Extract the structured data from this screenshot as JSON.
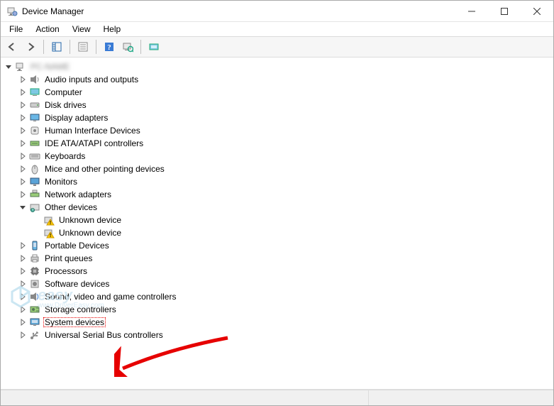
{
  "window": {
    "title": "Device Manager"
  },
  "menu": {
    "file": "File",
    "action": "Action",
    "view": "View",
    "help": "Help"
  },
  "toolbar": {
    "back": "Back",
    "forward": "Forward",
    "show_hide_tree": "Show/Hide Console Tree",
    "properties": "Properties",
    "help": "Help",
    "scan": "Scan for hardware changes",
    "show_hidden": "Show hidden devices"
  },
  "tree": {
    "root_label": "PC-NAME",
    "items": [
      {
        "label": "Audio inputs and outputs",
        "icon": "audio"
      },
      {
        "label": "Computer",
        "icon": "computer"
      },
      {
        "label": "Disk drives",
        "icon": "disk"
      },
      {
        "label": "Display adapters",
        "icon": "display"
      },
      {
        "label": "Human Interface Devices",
        "icon": "hid"
      },
      {
        "label": "IDE ATA/ATAPI controllers",
        "icon": "ide"
      },
      {
        "label": "Keyboards",
        "icon": "keyboard"
      },
      {
        "label": "Mice and other pointing devices",
        "icon": "mouse"
      },
      {
        "label": "Monitors",
        "icon": "monitor"
      },
      {
        "label": "Network adapters",
        "icon": "network"
      },
      {
        "label": "Other devices",
        "icon": "other",
        "expanded": true,
        "children": [
          {
            "label": "Unknown device",
            "icon": "warning"
          },
          {
            "label": "Unknown device",
            "icon": "warning"
          }
        ]
      },
      {
        "label": "Portable Devices",
        "icon": "portable"
      },
      {
        "label": "Print queues",
        "icon": "printer"
      },
      {
        "label": "Processors",
        "icon": "cpu"
      },
      {
        "label": "Software devices",
        "icon": "software"
      },
      {
        "label": "Sound, video and game controllers",
        "icon": "sound"
      },
      {
        "label": "Storage controllers",
        "icon": "storage"
      },
      {
        "label": "System devices",
        "icon": "system",
        "selected": true
      },
      {
        "label": "Universal Serial Bus controllers",
        "icon": "usb"
      }
    ]
  },
  "watermark": {
    "brand": "easy",
    "sub": "www.DriverEasy.com"
  }
}
